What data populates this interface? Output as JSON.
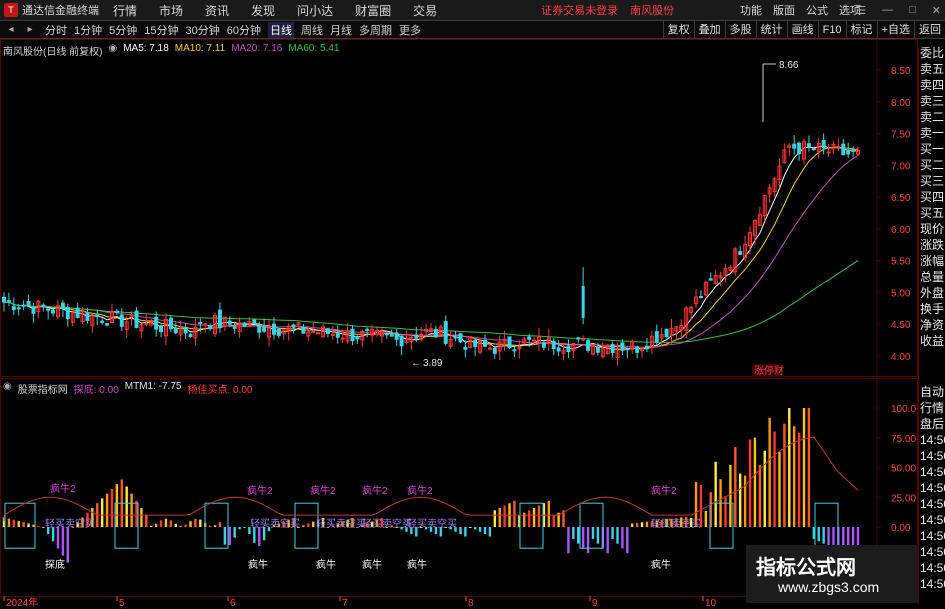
{
  "menubar": {
    "app_title": "通达信金融终端",
    "menus": [
      "行情",
      "市场",
      "资讯",
      "发现",
      "问小达",
      "财富圈",
      "交易"
    ],
    "alert": "证券交易未登录",
    "stock_alert": "南风股份",
    "right_items": [
      "功能",
      "版面",
      "公式",
      "选项"
    ],
    "window_controls": [
      "☰",
      "—",
      "□",
      "✕"
    ]
  },
  "toolbar": {
    "periods": [
      "分时",
      "1分钟",
      "5分钟",
      "15分钟",
      "30分钟",
      "60分钟",
      "日线",
      "周线",
      "月线",
      "多周期",
      "更多"
    ],
    "active_period": "日线",
    "right_tabs": [
      "复权",
      "叠加",
      "多股",
      "统计",
      "画线",
      "F10",
      "标记",
      "+自选",
      "返回"
    ]
  },
  "main_chart": {
    "title": "南风股份(日线 前复权)",
    "ma5": "MA5: 7.18",
    "ma10": "MA10: 7.11",
    "ma20": "MA20: 7.16",
    "ma60": "MA60: 5.41",
    "high_label": "8.66",
    "low_label": "3.89",
    "tag": "涨停财",
    "y_ticks": [
      "8.50",
      "8.00",
      "7.50",
      "7.00",
      "6.50",
      "6.00",
      "5.50",
      "5.00",
      "4.50",
      "4.00"
    ]
  },
  "sub_chart": {
    "title": "股票指标网",
    "s1": "探底: 0.00",
    "s2": "MTM1: -7.75",
    "s3": "杨佳买点: 0.00",
    "y_ticks": [
      "100.0",
      "75.00",
      "50.00",
      "25.00",
      "0.00"
    ],
    "label_niu2": "疯牛2",
    "label_shortsell": "轻买卖空买",
    "label_niu": "疯牛",
    "label_bottom": "探底"
  },
  "x_axis": [
    "2024年",
    "5",
    "6",
    "7",
    "8",
    "9",
    "10"
  ],
  "sidebar": [
    "委比",
    "卖五",
    "卖四",
    "卖三",
    "卖二",
    "卖一",
    "买一",
    "买二",
    "买三",
    "买四",
    "买五",
    "现价",
    "涨跌",
    "涨幅",
    "总量",
    "外盘",
    "换手",
    "净资",
    "收益"
  ],
  "sidebar2": [
    "自动",
    "行情",
    "盘后",
    "14:50",
    "14:50",
    "14:50",
    "14:50",
    "14:50",
    "14:50",
    "14:50",
    "14:50",
    "14:50",
    "14:50"
  ],
  "watermark": {
    "title": "指标公式网",
    "url": "www.zbgs3.com"
  },
  "colors": {
    "up": "#ff3333",
    "down": "#33d6e8",
    "ma5": "#ffffff",
    "ma10": "#f4d000",
    "ma20": "#cc44cc",
    "ma60": "#2ec82e",
    "grid": "#5a0000"
  }
}
